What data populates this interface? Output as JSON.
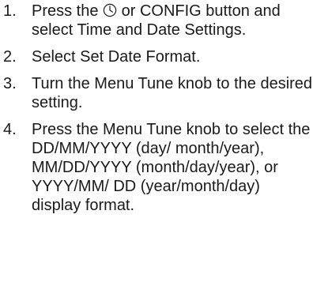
{
  "steps": [
    {
      "number": "1.",
      "text_before_icon": "Press the ",
      "icon": "clock-icon",
      "text_after_icon": " or CONFIG button and select Time and Date Settings."
    },
    {
      "number": "2.",
      "text": "Select Set Date Format."
    },
    {
      "number": "3.",
      "text": "Turn the Menu Tune knob to the desired setting."
    },
    {
      "number": "4.",
      "text": "Press the Menu Tune knob to select the DD/MM/YYYY (day/ month/year), MM/DD/YYYY (month/day/year), or YYYY/MM/ DD (year/month/day) display format."
    }
  ]
}
